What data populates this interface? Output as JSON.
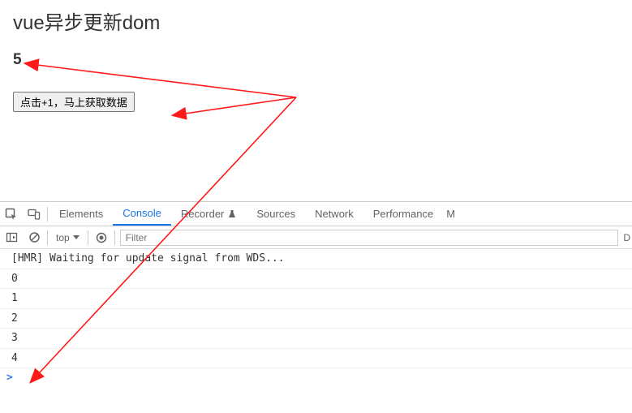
{
  "app": {
    "title": "vue异步更新dom",
    "count": "5",
    "button_label": "点击+1，马上获取数据"
  },
  "devtools": {
    "tabs": {
      "elements": "Elements",
      "console": "Console",
      "recorder": "Recorder",
      "sources": "Sources",
      "network": "Network",
      "performance": "Performance",
      "more": "M"
    },
    "toolbar": {
      "top": "top",
      "filter_placeholder": "Filter",
      "default_label": "D"
    },
    "console": {
      "lines": [
        "[HMR] Waiting for update signal from WDS...",
        "0",
        "1",
        "2",
        "3",
        "4"
      ],
      "prompt": ">"
    }
  }
}
